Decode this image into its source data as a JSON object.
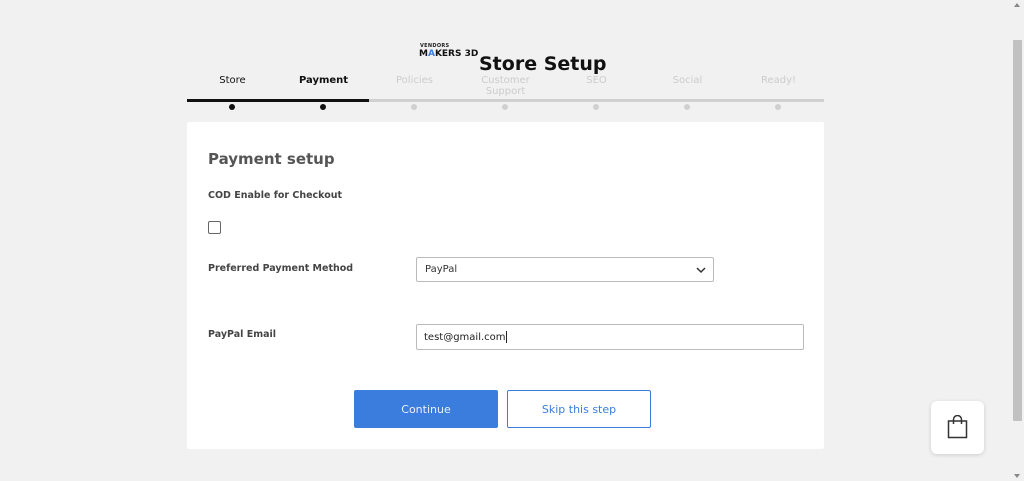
{
  "brand": {
    "small": "VENDORS",
    "main_prefix": "M",
    "main_accent": "A",
    "main_suffix": "KERS 3D"
  },
  "header": {
    "title": "Store Setup"
  },
  "steps": [
    {
      "label": "Store",
      "state": "done"
    },
    {
      "label": "Payment",
      "state": "active"
    },
    {
      "label": "Policies",
      "state": "pending"
    },
    {
      "label": "Customer Support",
      "state": "pending"
    },
    {
      "label": "SEO",
      "state": "pending"
    },
    {
      "label": "Social",
      "state": "pending"
    },
    {
      "label": "Ready!",
      "state": "pending"
    }
  ],
  "form": {
    "heading": "Payment setup",
    "cod_label": "COD Enable for Checkout",
    "cod_checked": false,
    "method_label": "Preferred Payment Method",
    "method_value": "PayPal",
    "email_label": "PayPal Email",
    "email_value": "test@gmail.com"
  },
  "buttons": {
    "continue": "Continue",
    "skip": "Skip this step"
  },
  "colors": {
    "accent": "#3b7ddd",
    "active_step": "#111111",
    "pending_step": "#cccccc"
  }
}
